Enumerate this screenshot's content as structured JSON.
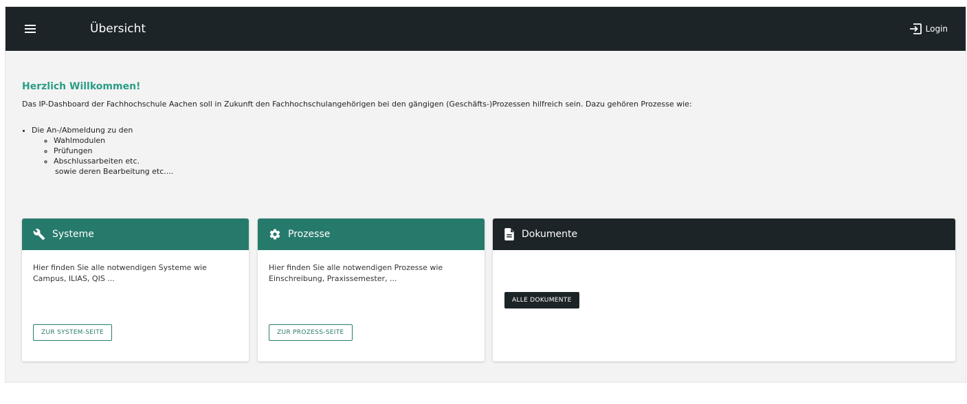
{
  "header": {
    "title": "Übersicht",
    "login_label": "Login"
  },
  "intro": {
    "heading": "Herzlich Willkommen!",
    "text": "Das IP-Dashboard der Fachhochschule Aachen soll in Zukunft den Fachhochschulangehörigen bei den gängigen (Geschäfts-)Prozessen hilfreich sein. Dazu gehören Prozesse wie:",
    "list_item": "Die An-/Abmeldung zu den",
    "sub_items": [
      "Wahlmodulen",
      "Prüfungen",
      "Abschlussarbeiten etc."
    ],
    "after_note": "sowie deren Bearbeitung etc...."
  },
  "cards": [
    {
      "title": "Systeme",
      "icon": "wrench-icon",
      "body": "Hier finden Sie alle notwendigen Systeme wie Campus, ILIAS, QIS ...",
      "button": "ZUR SYSTEM-SEITE",
      "header_color": "#267a6c"
    },
    {
      "title": "Prozesse",
      "icon": "gear-icon",
      "body": "Hier finden Sie alle notwendigen Prozesse wie Einschreibung, Praxissemester, ...",
      "button": "ZUR PROZESS-SEITE",
      "header_color": "#267a6c"
    },
    {
      "title": "Dokumente",
      "icon": "document-icon",
      "body": "",
      "button": "ALLE DOKUMENTE",
      "header_color": "#1c2428"
    }
  ]
}
